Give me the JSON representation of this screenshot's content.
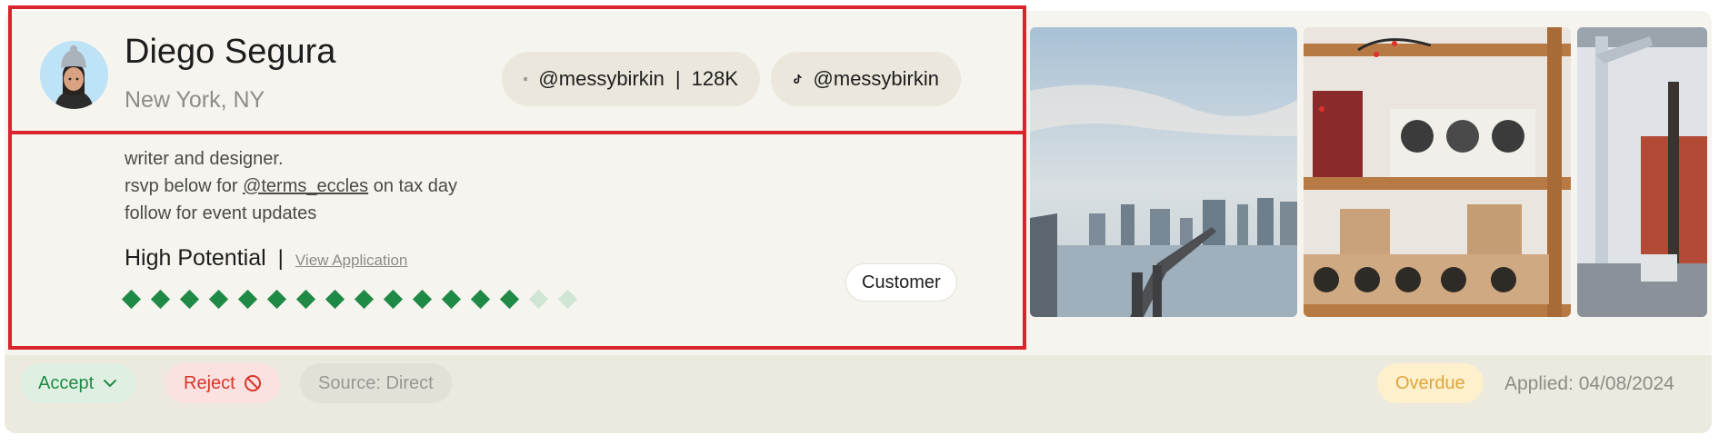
{
  "profile": {
    "name": "Diego Segura",
    "location": "New York, NY",
    "instagram": {
      "handle": "@messybirkin",
      "followers": "128K",
      "separator": "|"
    },
    "tiktok": {
      "handle": "@messybirkin"
    },
    "bio": {
      "line1": "writer and designer.",
      "line2_before": "rsvp below for ",
      "line2_mention": "@terms_eccles",
      "line2_after": " on tax day",
      "line3": "follow for event updates"
    },
    "potential": {
      "label": "High Potential",
      "separator": "|",
      "link": "View Application"
    },
    "rating": {
      "filled": 14,
      "total": 16,
      "filled_color": "#1f8a45",
      "empty_color": "#cfe6d4"
    },
    "tag": "Customer"
  },
  "photos": [
    {
      "name": "city-skyline-bridge-photo"
    },
    {
      "name": "rubber-stamps-shelf-photo"
    },
    {
      "name": "street-scaffolding-photo"
    }
  ],
  "footer": {
    "accept_label": "Accept",
    "reject_label": "Reject",
    "source_label": "Source: Direct",
    "status_label": "Overdue",
    "applied_label": "Applied: 04/08/2024"
  },
  "colors": {
    "highlight": "#d9232d",
    "accept": "#1f8a45",
    "reject": "#d9342a",
    "overdue": "#e0a53b"
  }
}
